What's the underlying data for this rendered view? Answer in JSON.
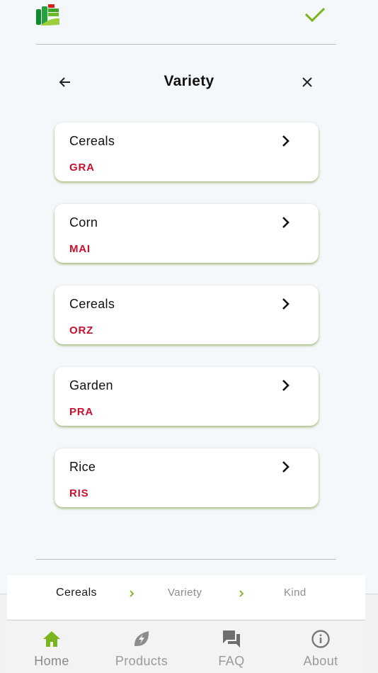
{
  "colors": {
    "accent": "#7ab51d",
    "code": "#c8102e",
    "text": "#111111",
    "muted": "#9a9a9a"
  },
  "header": {
    "logo_icon": "brand-logo-icon",
    "confirm_icon": "check-icon"
  },
  "title_bar": {
    "title": "Variety",
    "back_icon": "arrow-left-icon",
    "close_icon": "close-icon"
  },
  "items": [
    {
      "name": "Cereals",
      "code": "GRA"
    },
    {
      "name": "Corn",
      "code": "MAI"
    },
    {
      "name": "Cereals",
      "code": "ORZ"
    },
    {
      "name": "Garden",
      "code": "PRA"
    },
    {
      "name": "Rice",
      "code": "RIS"
    }
  ],
  "breadcrumb": [
    {
      "label": "Cereals",
      "state": "current"
    },
    {
      "label": "Variety",
      "state": "pending"
    },
    {
      "label": "Kind",
      "state": "pending"
    }
  ],
  "nav": [
    {
      "label": "Home",
      "icon": "home-icon",
      "active": true
    },
    {
      "label": "Products",
      "icon": "leaf-bolt-icon",
      "active": false
    },
    {
      "label": "FAQ",
      "icon": "chat-bubbles-icon",
      "active": false
    },
    {
      "label": "About",
      "icon": "info-icon",
      "active": false
    }
  ]
}
